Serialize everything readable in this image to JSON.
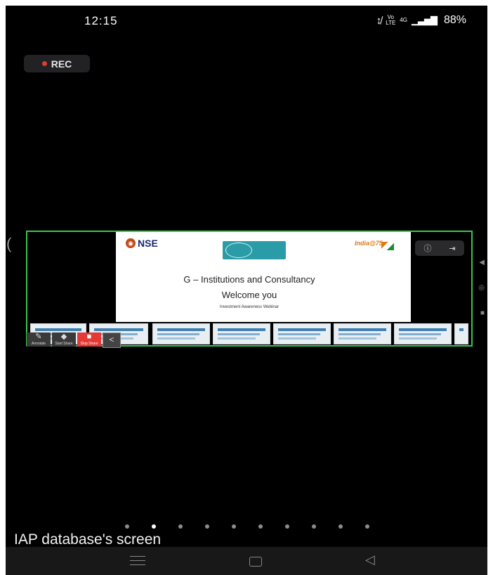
{
  "status_bar": {
    "time": "12:15",
    "mute_icon": "mute-vibrate-icon",
    "volte_top": "Vo",
    "volte_bottom": "LTE",
    "network": "4G",
    "signal_icon": "signal-bars-icon",
    "battery": "88%"
  },
  "recording": {
    "label": "REC",
    "dot_color": "#e53935"
  },
  "shared_screen": {
    "border_color": "#35c84a",
    "slide": {
      "logo_text": "NSE",
      "title": "G – Institutions and Consultancy",
      "subtitle": "Welcome you",
      "caption": "Investment Awareness Webinar",
      "partner_logo": "India@75"
    },
    "controls": {
      "info_icon": "info-icon",
      "exit_icon": "exit-icon"
    }
  },
  "toolbar": {
    "annotate": "Annotate",
    "share": "Start Share",
    "stop": "Stop Share",
    "back_icon": "chevron-left-icon"
  },
  "pager": {
    "count": 10,
    "active_index": 1
  },
  "screen_label": "IAP database's screen",
  "nav_bar": {
    "menu_icon": "menu-icon",
    "home_icon": "home-icon",
    "back_icon": "back-icon"
  }
}
